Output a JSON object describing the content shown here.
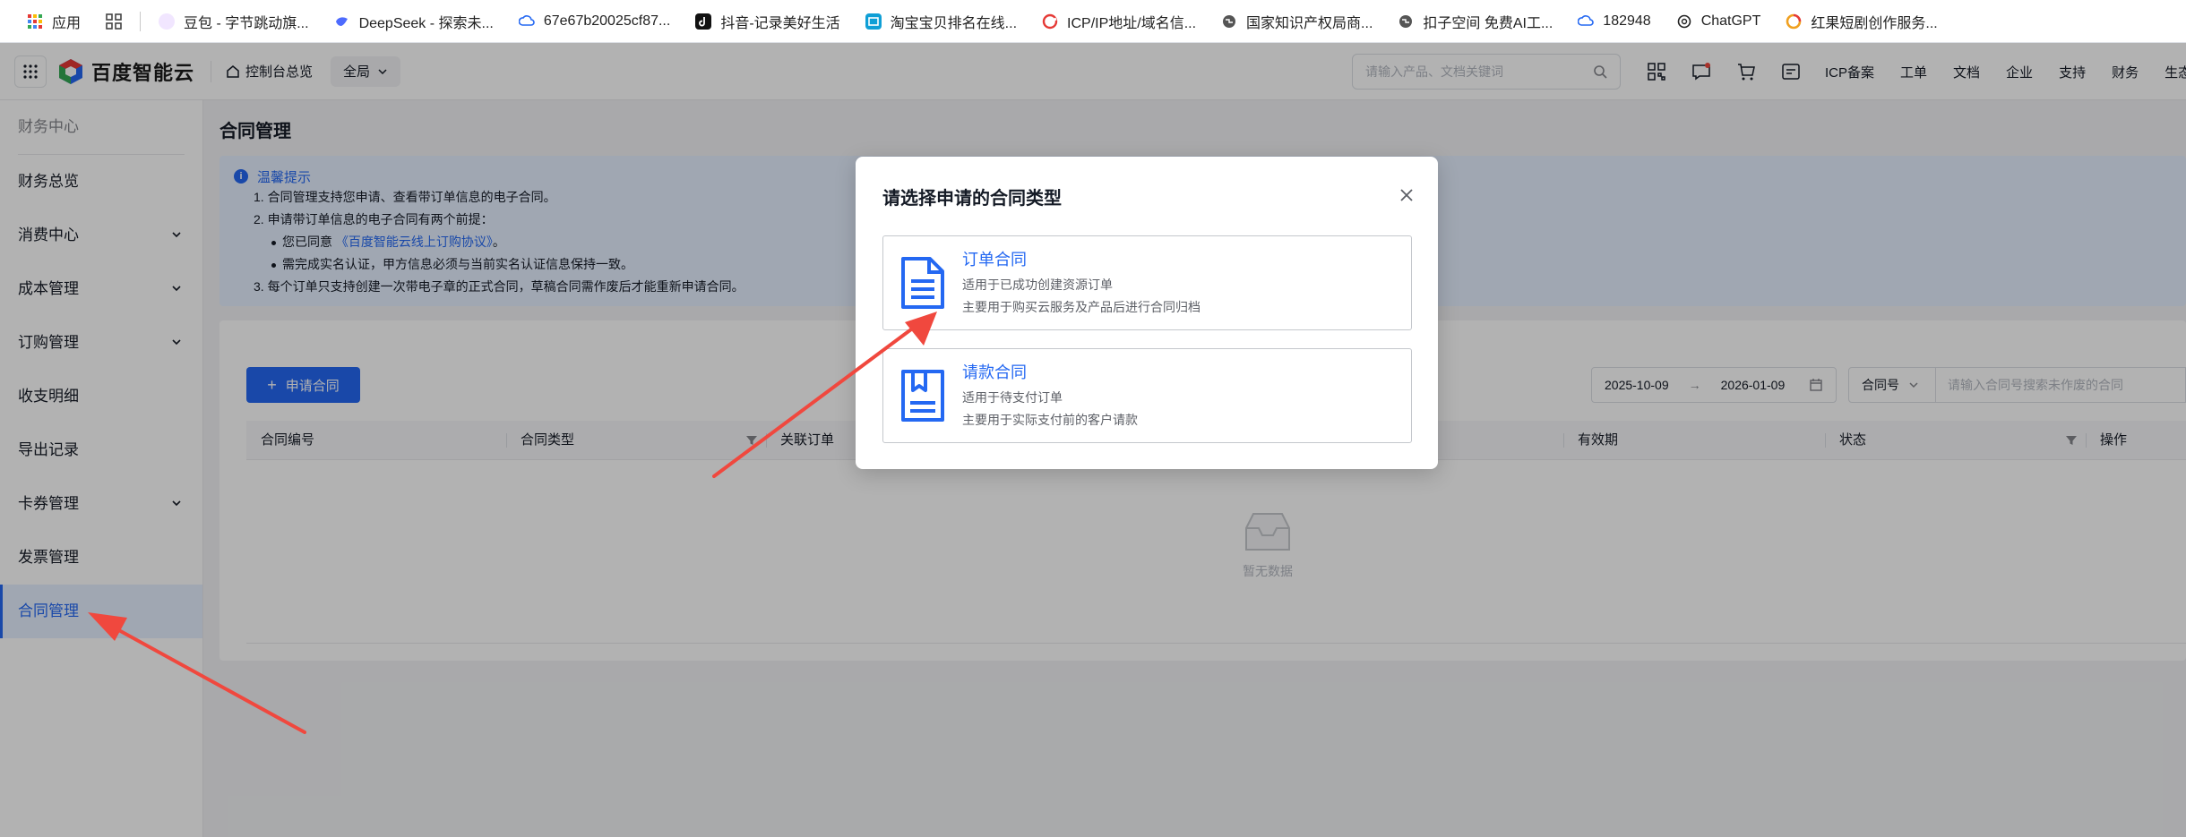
{
  "bookmarks": [
    {
      "label": "应用",
      "icon": "apps-grid-icon",
      "color": "#e53935"
    },
    {
      "label": "豆包 - 字节跳动旗...",
      "icon": "doubao-icon",
      "color": "#7a5cff"
    },
    {
      "label": "DeepSeek - 探索未...",
      "icon": "deepseek-icon",
      "color": "#4d6bfe"
    },
    {
      "label": "67e67b20025cf87...",
      "icon": "cloud-icon",
      "color": "#2468f2"
    },
    {
      "label": "抖音-记录美好生活",
      "icon": "douyin-icon",
      "color": "#111111"
    },
    {
      "label": "淘宝宝贝排名在线...",
      "icon": "shop-icon",
      "color": "#0f9fd6"
    },
    {
      "label": "ICP/IP地址/域名信...",
      "icon": "icp-icon",
      "color": "#e53935"
    },
    {
      "label": "国家知识产权局商...",
      "icon": "globe-icon",
      "color": "#555555"
    },
    {
      "label": "扣子空间 免费AI工...",
      "icon": "globe-icon",
      "color": "#555555"
    },
    {
      "label": "182948",
      "icon": "cloud-icon",
      "color": "#2468f2"
    },
    {
      "label": "ChatGPT",
      "icon": "chatgpt-icon",
      "color": "#222222"
    },
    {
      "label": "红果短剧创作服务...",
      "icon": "hongguo-icon",
      "color": "#f0a020"
    }
  ],
  "topnav": {
    "logo_text": "百度智能云",
    "home_label": "控制台总览",
    "scope_label": "全局",
    "search_placeholder": "请输入产品、文档关键词",
    "links": [
      "ICP备案",
      "工单",
      "文档",
      "企业",
      "支持",
      "财务",
      "生态"
    ]
  },
  "sidebar": {
    "header": "财务中心",
    "items": [
      {
        "label": "财务总览",
        "expandable": false,
        "active": false
      },
      {
        "label": "消费中心",
        "expandable": true,
        "active": false
      },
      {
        "label": "成本管理",
        "expandable": true,
        "active": false
      },
      {
        "label": "订购管理",
        "expandable": true,
        "active": false
      },
      {
        "label": "收支明细",
        "expandable": false,
        "active": false
      },
      {
        "label": "导出记录",
        "expandable": false,
        "active": false
      },
      {
        "label": "卡券管理",
        "expandable": true,
        "active": false
      },
      {
        "label": "发票管理",
        "expandable": false,
        "active": false
      },
      {
        "label": "合同管理",
        "expandable": false,
        "active": true
      }
    ]
  },
  "main": {
    "title": "合同管理",
    "tip": {
      "heading": "温馨提示",
      "line1": "1.  合同管理支持您申请、查看带订单信息的电子合同。",
      "line2": "2.  申请带订单信息的电子合同有两个前提：",
      "sub1_prefix": "您已同意 ",
      "sub1_link": "《百度智能云线上订购协议》",
      "sub1_suffix": "。",
      "sub2": "需完成实名认证，甲方信息必须与当前实名认证信息保持一致。",
      "line3": "3.  每个订单只支持创建一次带电子章的正式合同，草稿合同需作废后才能重新申请合同。"
    },
    "apply_button": "申请合同",
    "date_start": "2025-10-09",
    "date_arrow": "→",
    "date_end": "2026-01-09",
    "filter_field": "合同号",
    "filter_placeholder": "请输入合同号搜索未作废的合同",
    "columns": [
      "合同编号",
      "合同类型",
      "关联订单",
      "有效期",
      "状态",
      "操作"
    ],
    "empty_text": "暂无数据"
  },
  "dialog": {
    "title": "请选择申请的合同类型",
    "options": [
      {
        "title": "订单合同",
        "desc1": "适用于已成功创建资源订单",
        "desc2": "主要用于购买云服务及产品后进行合同归档",
        "icon": "document-icon"
      },
      {
        "title": "请款合同",
        "desc1": "适用于待支付订单",
        "desc2": "主要用于实际支付前的客户请款",
        "icon": "bookmark-document-icon"
      }
    ]
  },
  "colors": {
    "accent": "#2468f2",
    "annotation_arrow": "#f0483e",
    "tip_background": "#e6f0ff"
  }
}
